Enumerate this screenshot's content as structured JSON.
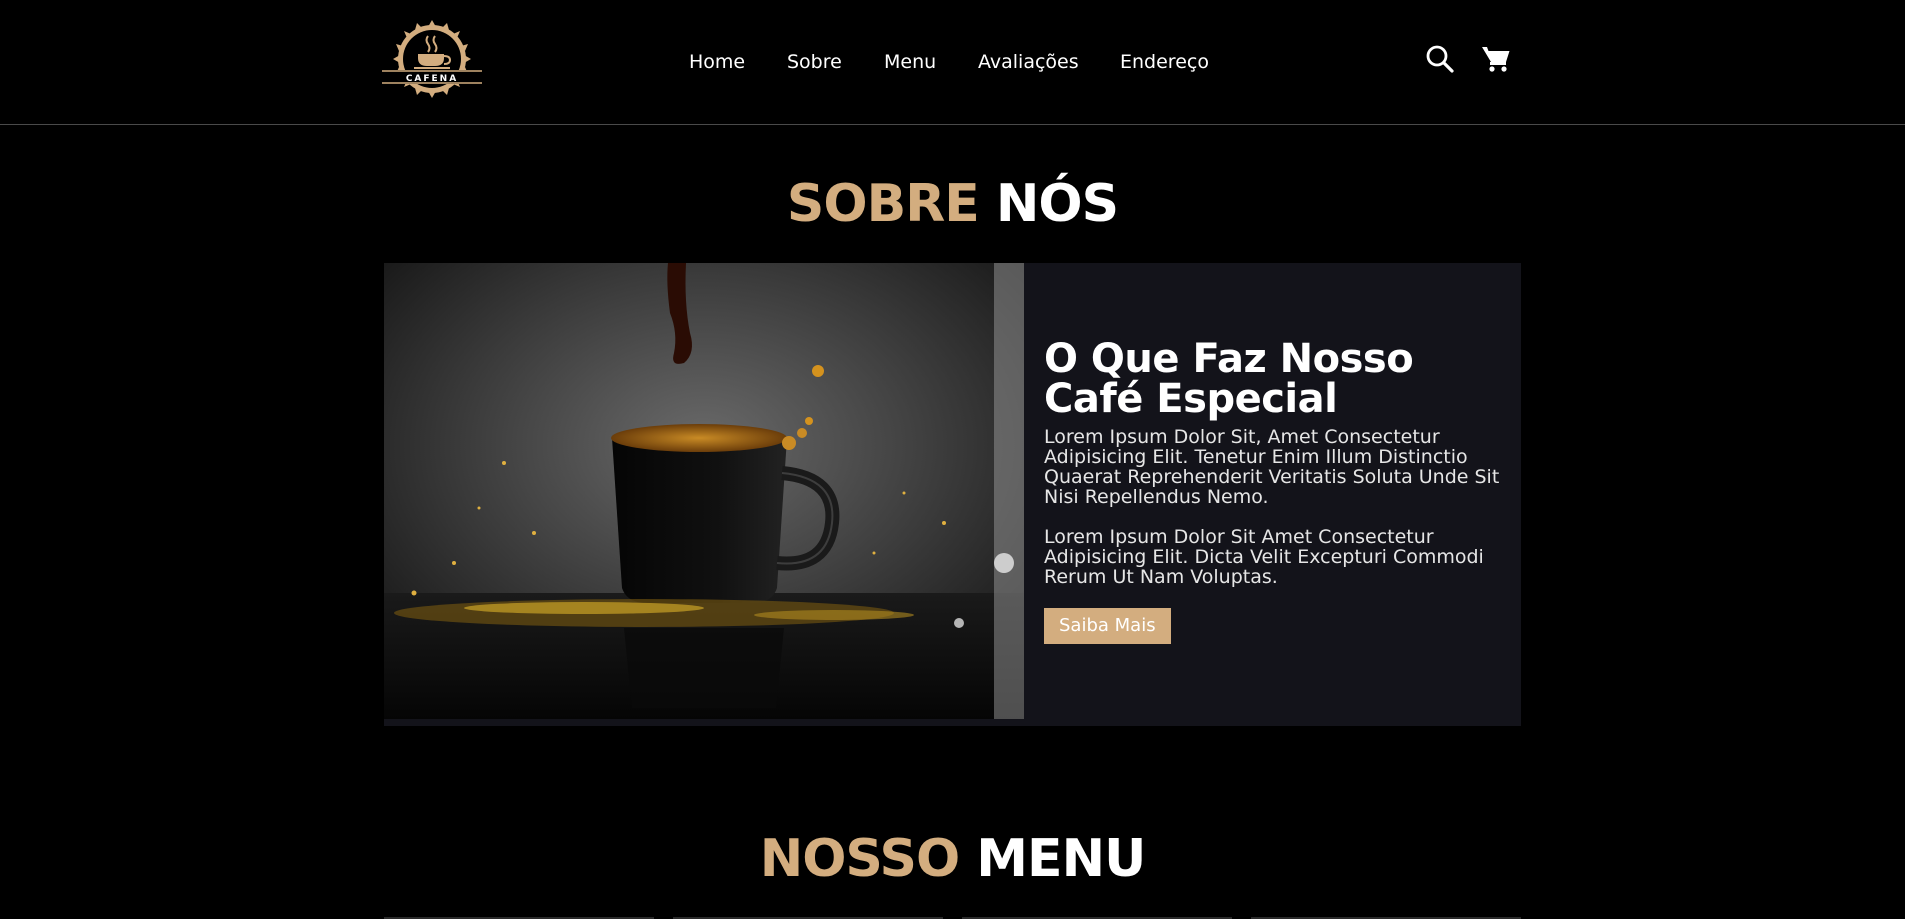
{
  "header": {
    "logo_text": "CAFENA",
    "nav": [
      "Home",
      "Sobre",
      "Menu",
      "Avaliações",
      "Endereço"
    ],
    "icons": [
      "search-icon",
      "cart-icon"
    ]
  },
  "about": {
    "title_accent": "SOBRE",
    "title_plain": "NÓS",
    "heading": "O Que Faz Nosso Café Especial",
    "paragraph1": "Lorem Ipsum Dolor Sit, Amet Consectetur Adipisicing Elit. Tenetur Enim Illum Distinctio Quaerat Reprehenderit Veritatis Soluta Unde Sit Nisi Repellendus Nemo.",
    "paragraph2": "Lorem Ipsum Dolor Sit Amet Consectetur Adipisicing Elit. Dicta Velit Excepturi Commodi Rerum Ut Nam Voluptas.",
    "button": "Saiba Mais"
  },
  "menu_section": {
    "title_accent": "NOSSO",
    "title_plain": "MENU"
  },
  "colors": {
    "accent": "#d3ad7f",
    "background": "#000000",
    "panel": "#13131a"
  }
}
